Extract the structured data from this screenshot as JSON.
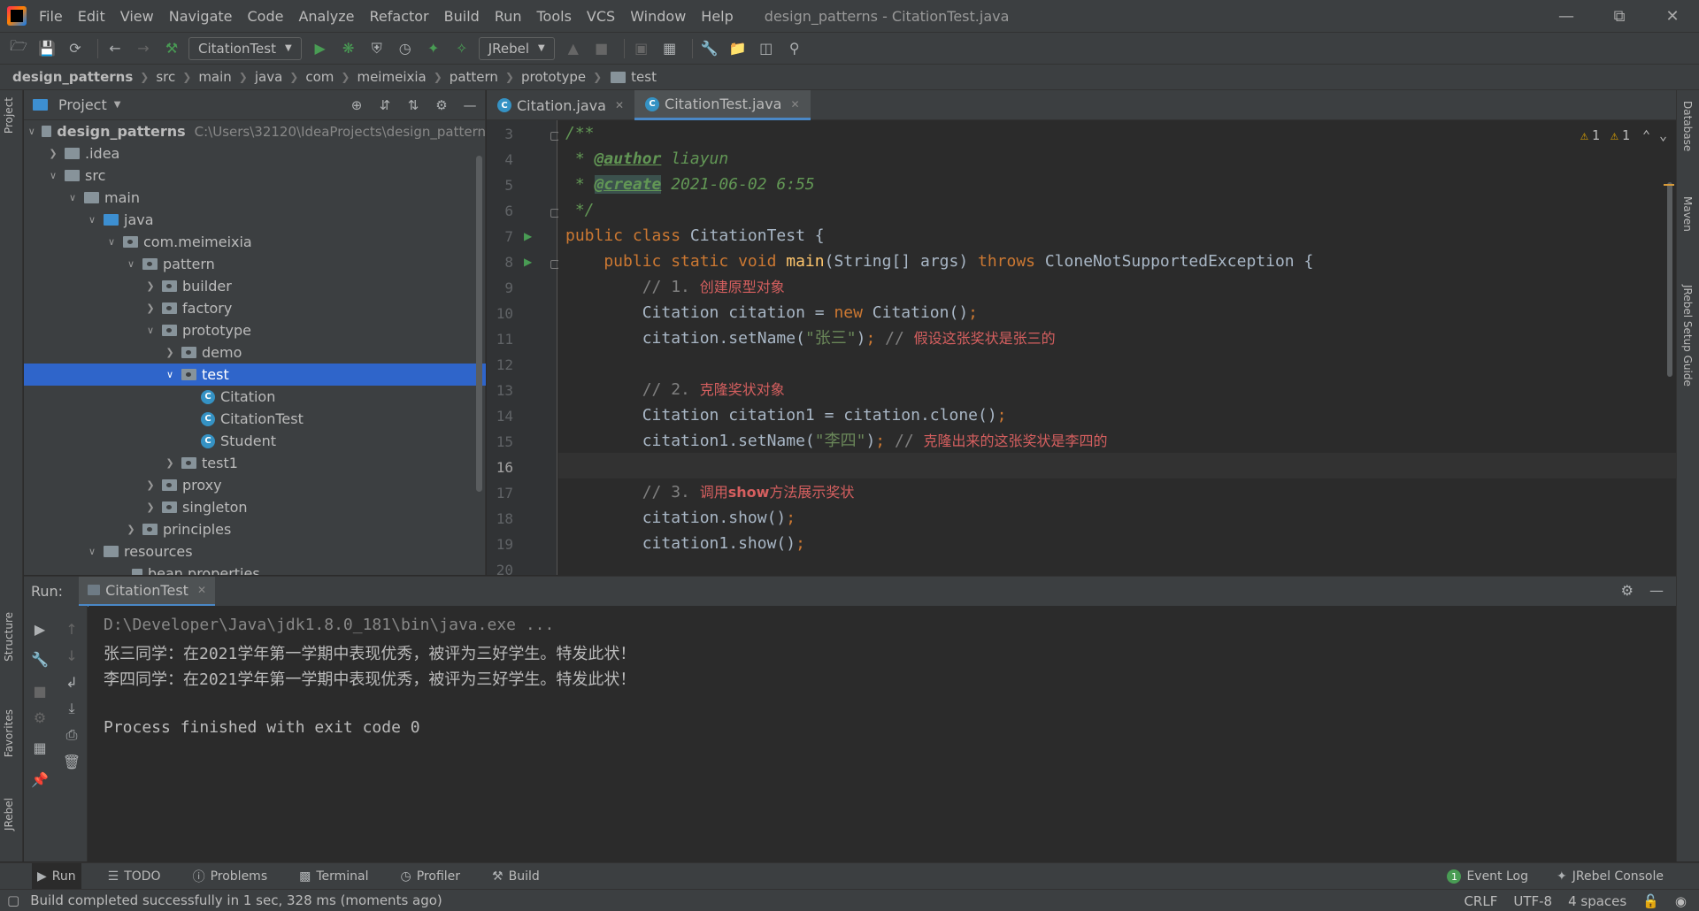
{
  "menubar": {
    "items": [
      "File",
      "Edit",
      "View",
      "Navigate",
      "Code",
      "Analyze",
      "Refactor",
      "Build",
      "Run",
      "Tools",
      "VCS",
      "Window",
      "Help"
    ],
    "window_title": "design_patterns - CitationTest.java"
  },
  "toolbar": {
    "run_config": "CitationTest",
    "jrebel_combo": "JRebel"
  },
  "breadcrumb": [
    "design_patterns",
    "src",
    "main",
    "java",
    "com",
    "meimeixia",
    "pattern",
    "prototype",
    "test"
  ],
  "left_stripe": {
    "project": "Project",
    "structure": "Structure",
    "favorites": "Favorites",
    "jrebel": "JRebel"
  },
  "right_stripe": {
    "database": "Database",
    "maven": "Maven",
    "jrebel_guide": "JRebel Setup Guide"
  },
  "project_panel": {
    "title": "Project",
    "tree": [
      {
        "label": "design_patterns",
        "hint": "C:\\Users\\32120\\IdeaProjects\\design_pattern"
      },
      {
        "label": ".idea"
      },
      {
        "label": "src"
      },
      {
        "label": "main"
      },
      {
        "label": "java"
      },
      {
        "label": "com.meimeixia"
      },
      {
        "label": "pattern"
      },
      {
        "label": "builder"
      },
      {
        "label": "factory"
      },
      {
        "label": "prototype"
      },
      {
        "label": "demo"
      },
      {
        "label": "test"
      },
      {
        "label": "Citation"
      },
      {
        "label": "CitationTest"
      },
      {
        "label": "Student"
      },
      {
        "label": "test1"
      },
      {
        "label": "proxy"
      },
      {
        "label": "singleton"
      },
      {
        "label": "principles"
      },
      {
        "label": "resources"
      },
      {
        "label": "bean.properties"
      }
    ]
  },
  "editor": {
    "tabs": [
      "Citation.java",
      "CitationTest.java"
    ],
    "warnings": {
      "a": "1",
      "b": "1"
    },
    "line_numbers": [
      "3",
      "4",
      "5",
      "6",
      "7",
      "8",
      "9",
      "10",
      "11",
      "12",
      "13",
      "14",
      "15",
      "16",
      "17",
      "18",
      "19",
      "20"
    ],
    "code": {
      "l3": "/**",
      "l4_prefix": " * ",
      "l4_tag": "@author",
      "l4_val": " liayun",
      "l5_prefix": " * ",
      "l5_tag": "@create",
      "l5_val": " 2021-06-02 6:55",
      "l6": " */",
      "l7_kw": "public class",
      "l7_rest": " CitationTest {",
      "l8_kw1": "    public static void",
      "l8_fn": " main",
      "l8_mid": "(String[] args) ",
      "l8_kw2": "throws",
      "l8_rest": " CloneNotSupportedException {",
      "l9_c": "        // 1. ",
      "l9_cn": "创建原型对象",
      "l10_a": "        Citation citation = ",
      "l10_kw": "new",
      "l10_b": " Citation()",
      "l10_semi": ";",
      "l11_a": "        citation.setName(",
      "l11_str": "\"张三\"",
      "l11_b": ")",
      "l11_semi": ";",
      "l11_c": " // ",
      "l11_cn": "假设这张奖状是张三的",
      "l13_c": "        // 2. ",
      "l13_cn": "克隆奖状对象",
      "l14_a": "        Citation citation1 = citation.clone()",
      "l14_semi": ";",
      "l15_a": "        citation1.setName(",
      "l15_str": "\"李四\"",
      "l15_b": ")",
      "l15_semi": ";",
      "l15_c": " // ",
      "l15_cn": "克隆出来的这张奖状是李四的",
      "l17_c": "        // 3. ",
      "l17_cn1": "调用",
      "l17_show": "show",
      "l17_cn2": "方法展示奖状",
      "l18_a": "        citation.show()",
      "l18_semi": ";",
      "l19_a": "        citation1.show()",
      "l19_semi": ";"
    }
  },
  "run_panel": {
    "label": "Run:",
    "tab": "CitationTest",
    "console": [
      "D:\\Developer\\Java\\jdk1.8.0_181\\bin\\java.exe ...",
      "张三同学：在2021学年第一学期中表现优秀，被评为三好学生。特发此状！",
      "李四同学：在2021学年第一学期中表现优秀，被评为三好学生。特发此状！",
      "",
      "Process finished with exit code 0"
    ]
  },
  "bottom_tools": [
    "Run",
    "TODO",
    "Problems",
    "Terminal",
    "Profiler",
    "Build"
  ],
  "bottom_right": {
    "event_log": "Event Log",
    "event_count": "1",
    "jrebel_console": "JRebel Console"
  },
  "status": {
    "message": "Build completed successfully in 1 sec, 328 ms (moments ago)",
    "line_sep": "CRLF",
    "encoding": "UTF-8",
    "indent": "4 spaces"
  }
}
